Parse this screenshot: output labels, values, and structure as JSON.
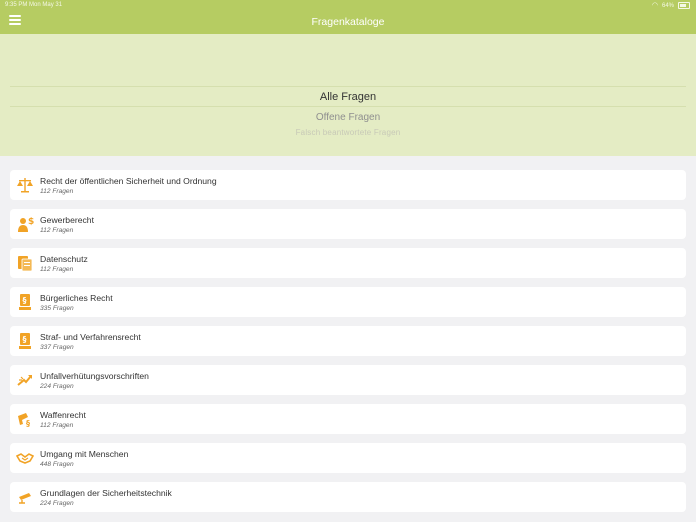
{
  "status_bar": {
    "time": "9:35 PM",
    "date": "Mon May 31",
    "battery": "64%"
  },
  "navbar": {
    "title": "Fragenkataloge",
    "menu_icon": "hamburger-menu-icon"
  },
  "filter_picker": {
    "selected": "Alle Fragen",
    "options": [
      "Alle Fragen",
      "Offene Fragen",
      "Falsch beantwortete Fragen"
    ]
  },
  "catalogs": [
    {
      "title": "Recht der öffentlichen Sicherheit und Ordnung",
      "count": "112 Fragen",
      "icon": "scales-icon"
    },
    {
      "title": "Gewerberecht",
      "count": "112 Fragen",
      "icon": "person-money-icon"
    },
    {
      "title": "Datenschutz",
      "count": "112 Fragen",
      "icon": "documents-icon"
    },
    {
      "title": "Bürgerliches Recht",
      "count": "335 Fragen",
      "icon": "law-book-bgb-icon"
    },
    {
      "title": "Straf- und Verfahrensrecht",
      "count": "337 Fragen",
      "icon": "law-book-stpo-icon"
    },
    {
      "title": "Unfallverhütungsvorschriften",
      "count": "224 Fragen",
      "icon": "broken-arrow-icon"
    },
    {
      "title": "Waffenrecht",
      "count": "112 Fragen",
      "icon": "weapon-law-icon"
    },
    {
      "title": "Umgang mit Menschen",
      "count": "448 Fragen",
      "icon": "handshake-icon"
    },
    {
      "title": "Grundlagen der Sicherheitstechnik",
      "count": "224 Fragen",
      "icon": "camera-icon"
    }
  ],
  "colors": {
    "navbar": "#b6cc62",
    "picker_background": "#e4ecc4",
    "icon_orange": "#f1a326",
    "list_background": "#f1f1f3"
  }
}
